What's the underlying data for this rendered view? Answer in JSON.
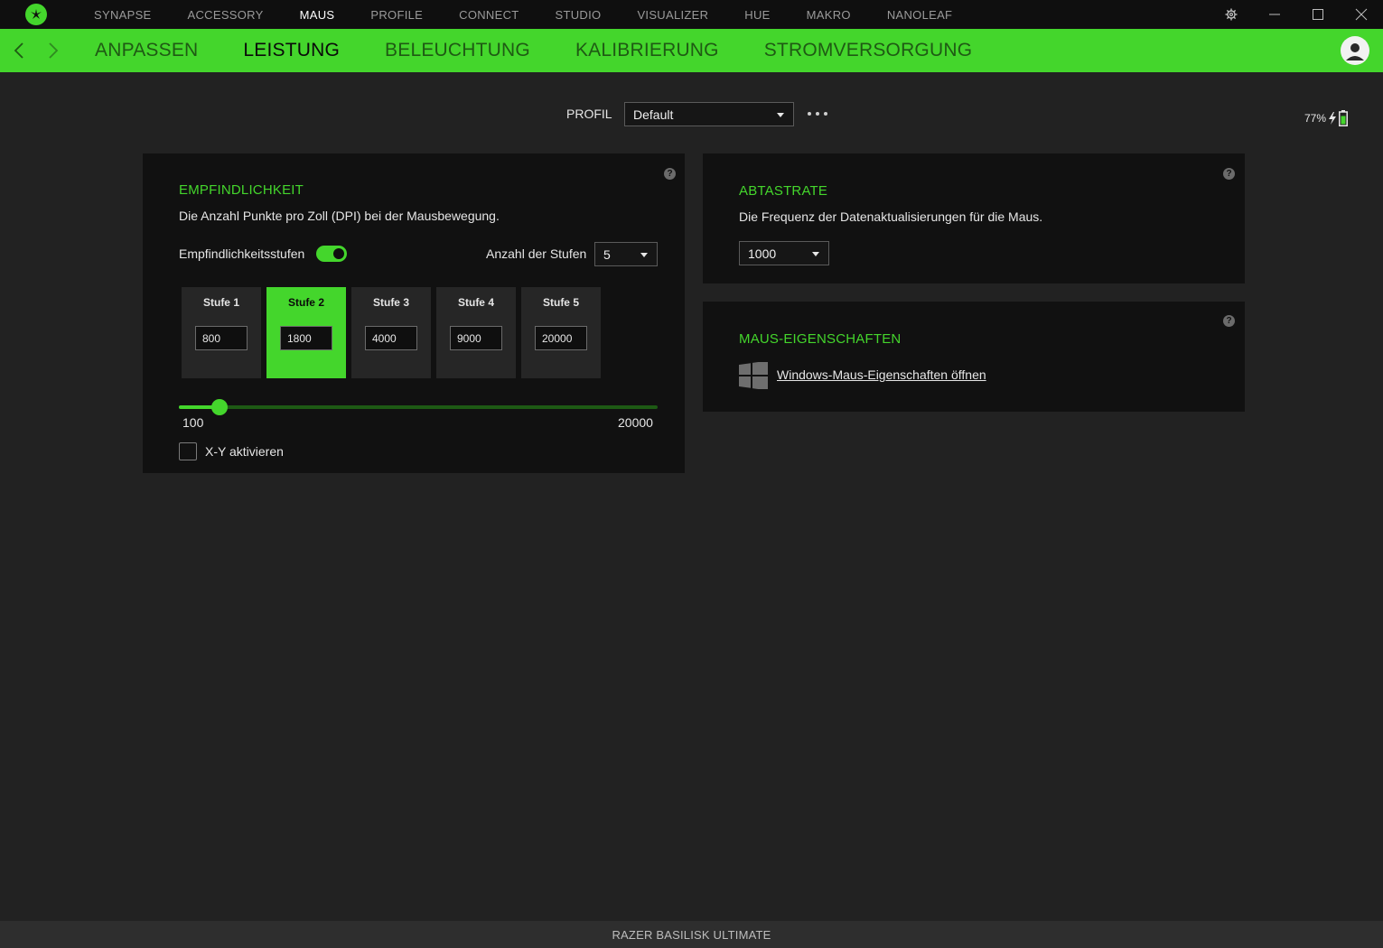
{
  "app": {
    "logo_icon": "razer-logo-icon",
    "accent_color": "#44d62c"
  },
  "top_nav": [
    "SYNAPSE",
    "ACCESSORY",
    "MAUS",
    "PROFILE",
    "CONNECT",
    "STUDIO",
    "VISUALIZER",
    "HUE",
    "MAKRO",
    "NANOLEAF"
  ],
  "top_nav_active": "MAUS",
  "window_controls": [
    "gear-icon",
    "minimize-icon",
    "maximize-icon",
    "close-icon"
  ],
  "sub_nav": [
    "ANPASSEN",
    "LEISTUNG",
    "BELEUCHTUNG",
    "KALIBRIERUNG",
    "STROMVERSORGUNG"
  ],
  "sub_nav_active": "LEISTUNG",
  "profile": {
    "label": "PROFIL",
    "value": "Default"
  },
  "battery": {
    "percent_text": "77%",
    "level": 0.77,
    "charging": true
  },
  "sensitivity": {
    "title": "EMPFINDLICHKEIT",
    "description": "Die Anzahl Punkte pro Zoll (DPI) bei der Mausbewegung.",
    "stages_toggle_label": "Empfindlichkeitsstufen",
    "stages_enabled": true,
    "stage_count_label": "Anzahl der Stufen",
    "stage_count": "5",
    "stages": [
      {
        "label": "Stufe 1",
        "value": "800"
      },
      {
        "label": "Stufe 2",
        "value": "1800"
      },
      {
        "label": "Stufe 3",
        "value": "4000"
      },
      {
        "label": "Stufe 4",
        "value": "9000"
      },
      {
        "label": "Stufe 5",
        "value": "20000"
      }
    ],
    "active_stage_index": 1,
    "slider": {
      "min": 100,
      "max": 20000,
      "min_label": "100",
      "max_label": "20000",
      "value": 1800
    },
    "xy_label": "X-Y aktivieren",
    "xy_enabled": false
  },
  "polling": {
    "title": "ABTASTRATE",
    "description": "Die Frequenz der Datenaktualisierungen für die Maus.",
    "value": "1000"
  },
  "mouse_properties": {
    "title": "MAUS-EIGENSCHAFTEN",
    "link": "Windows-Maus-Eigenschaften öffnen",
    "icon": "windows-icon"
  },
  "footer": {
    "device_name": "RAZER BASILISK ULTIMATE"
  }
}
